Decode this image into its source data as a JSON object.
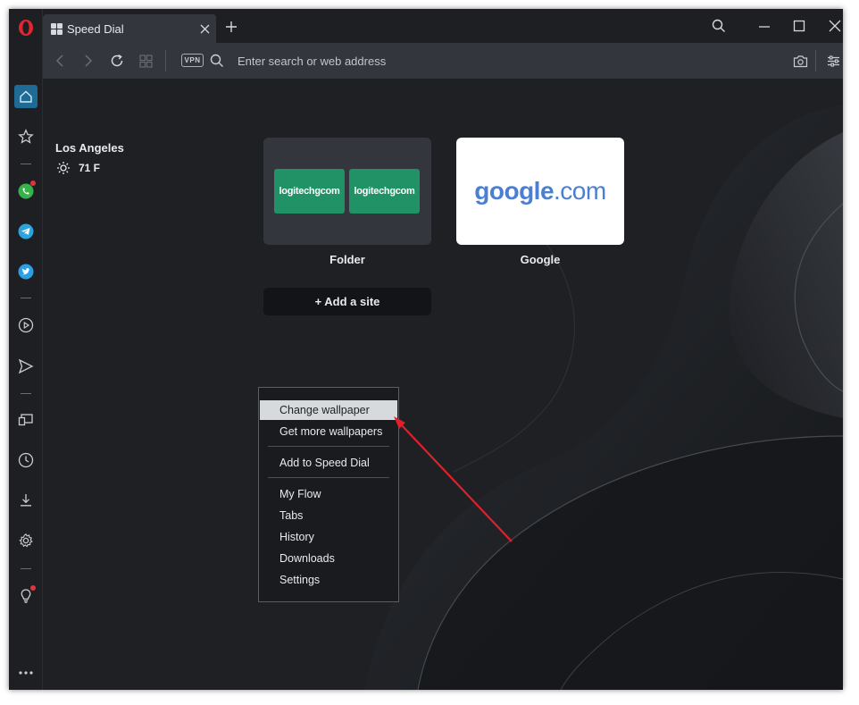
{
  "tab": {
    "title": "Speed Dial"
  },
  "address_bar": {
    "vpn_label": "VPN",
    "placeholder": "Enter search or web address"
  },
  "weather": {
    "city": "Los Angeles",
    "temperature": "71 F"
  },
  "speed_dial": {
    "tiles": [
      {
        "label": "Folder",
        "thumbnails": [
          "logitechgcom",
          "logitechgcom"
        ]
      },
      {
        "label": "Google",
        "logo_main": "google",
        "logo_tld": ".com"
      }
    ],
    "add_site": "+ Add a site"
  },
  "context_menu": {
    "items": [
      "Change wallpaper",
      "Get more wallpapers",
      "Add to Speed Dial",
      "My Flow",
      "Tabs",
      "History",
      "Downloads",
      "Settings"
    ],
    "highlighted_index": 0
  },
  "colors": {
    "accent": "#3aa5d8",
    "opera_red": "#e2262f",
    "tile_green": "#219166",
    "annotation_arrow": "#e0202a"
  }
}
